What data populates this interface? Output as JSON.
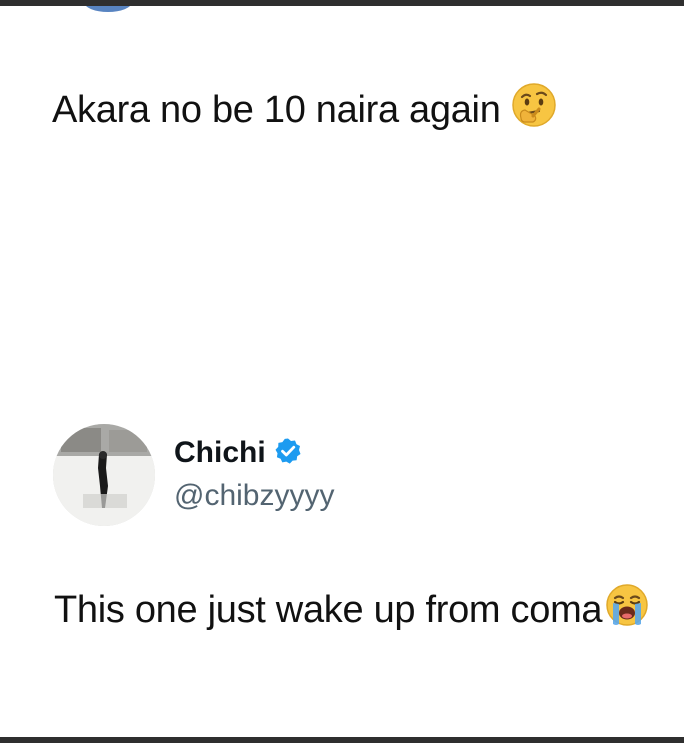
{
  "quoted_tweet": {
    "text": "Akara no be 10 naira again",
    "emoji": "thinking-face-emoji"
  },
  "reply": {
    "user": {
      "display_name": "Chichi",
      "handle": "@chibzyyyy",
      "verified": true,
      "verified_color": "#1d9bf0"
    },
    "text": "This one just wake up from coma",
    "emoji": "loudly-crying-face-emoji"
  }
}
